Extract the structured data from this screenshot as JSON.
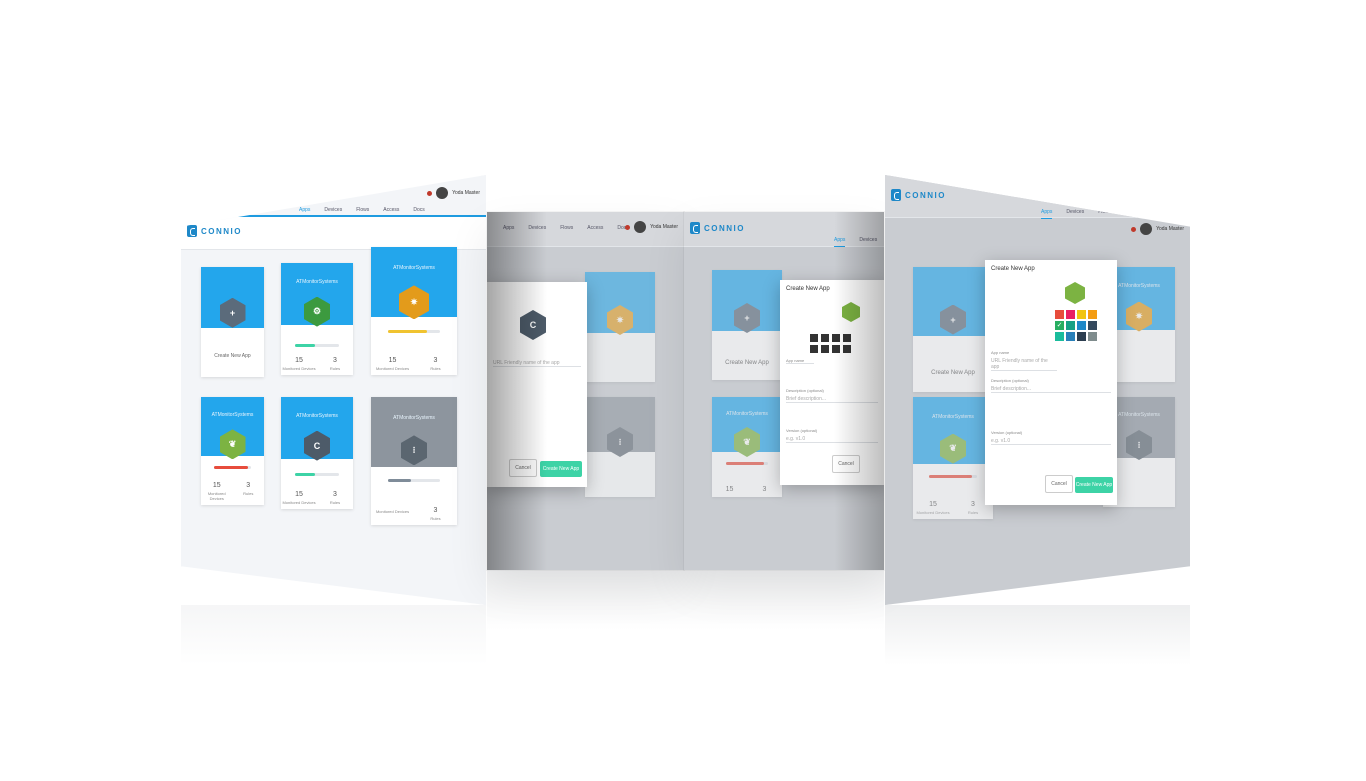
{
  "brand": {
    "name": "CONNIO"
  },
  "nav": [
    "Apps",
    "Devices",
    "Flows",
    "Access",
    "Docs"
  ],
  "user": {
    "name": "Yoda Master"
  },
  "colors": {
    "accent": "#1e9be0",
    "brand": "#1e88c8",
    "create_green": "#3dd3a6",
    "grey_card": "#8d959e"
  },
  "apps": [
    {
      "title": "",
      "action": "Create New App",
      "icon": "plus-icon",
      "color": "#5b6b7b"
    },
    {
      "title": "ATMonitorSystems",
      "icon": "robot-icon",
      "color": "#3c9a3f",
      "progress": 0.45,
      "progress_color": "#3dd3a6",
      "devices": "15",
      "devices_label": "Monitored Devices",
      "rules": "3",
      "rules_label": "Rules"
    },
    {
      "title": "ATMonitorSystems",
      "icon": "gear-icon",
      "color": "#e39b1b",
      "progress": 0.75,
      "progress_color": "#f0c330",
      "devices": "15",
      "devices_label": "Monitored Devices",
      "rules": "3",
      "rules_label": "Rules"
    },
    {
      "title": "ATMonitorSystems",
      "icon": "leaf-icon",
      "color": "#7cb342",
      "progress": 0.9,
      "progress_color": "#e74c3c",
      "devices": "15",
      "devices_label": "Monitored Devices",
      "rules": "3",
      "rules_label": "Rules"
    },
    {
      "title": "ATMonitorSystems",
      "icon": "connio-icon",
      "color": "#4d5b69",
      "progress": 0.45,
      "progress_color": "#3dd3a6",
      "devices": "15",
      "devices_label": "Monitored Devices",
      "rules": "3",
      "rules_label": "Rules"
    },
    {
      "title": "ATMonitorSystems",
      "icon": "traffic-light-icon",
      "color": "#5b6670",
      "progress": 0.45,
      "progress_color": "#7f8c99",
      "devices": "",
      "devices_label": "Monitored Devices",
      "rules": "3",
      "rules_label": "Rules"
    }
  ],
  "modal": {
    "title": "Create New App",
    "app_name_label": "App name",
    "app_name_placeholder": "URL Friendly name of the app",
    "description_label": "Description (optional)",
    "description_placeholder": "Brief description...",
    "version_label": "Version (optional)",
    "version_placeholder": "e.g. v1.0",
    "cancel": "Cancel",
    "create": "Create New App"
  },
  "palette": [
    "#e74c3c",
    "#e91e63",
    "#f1c40f",
    "#f39c12",
    "#27ae60",
    "#16a085",
    "#1e88c8",
    "#34495e",
    "#1abc9c",
    "#2980b9",
    "#2c3e50",
    "#7f8c8d"
  ]
}
